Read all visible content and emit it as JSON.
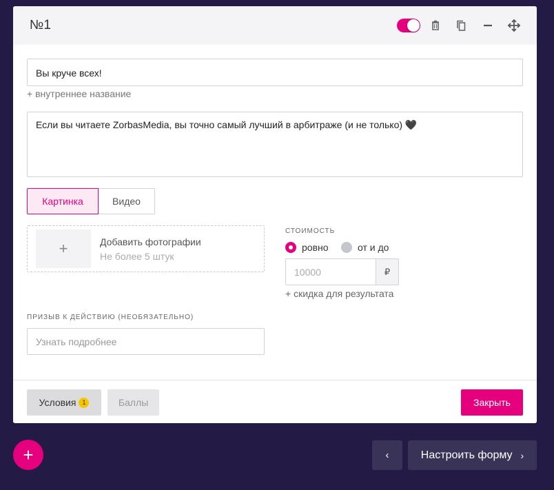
{
  "card": {
    "title": "№1",
    "name_value": "Вы круче всех!",
    "internal_name_link": "+ внутреннее название",
    "description_value": "Если вы читаете ZorbasMedia, вы точно самый лучший в арбитраже (и не только) 🖤",
    "media_tabs": [
      {
        "label": "Картинка",
        "active": true
      },
      {
        "label": "Видео",
        "active": false
      }
    ],
    "upload": {
      "plus": "+",
      "title": "Добавить фотографии",
      "hint": "Не более 5 штук"
    },
    "price": {
      "label": "СТОИМОСТЬ",
      "radio_exact": "ровно",
      "radio_range": "от и до",
      "selected": "ровно",
      "placeholder": "10000",
      "currency": "₽",
      "discount_link": "+ скидка для результата"
    },
    "cta": {
      "label": "ПРИЗЫВ К ДЕЙСТВИЮ (НЕОБЯЗАТЕЛЬНО)",
      "placeholder": "Узнать подробнее"
    },
    "footer": {
      "conditions_label": "Условия",
      "conditions_count": "1",
      "points_label": "Баллы",
      "close_label": "Закрыть"
    }
  },
  "bottom_bar": {
    "add": "+",
    "back": "‹",
    "configure_form": "Настроить форму",
    "forward": "›"
  },
  "colors": {
    "accent": "#e6007e",
    "background": "#231b45",
    "badge": "#f7c500"
  },
  "icons": [
    "toggle",
    "trash-icon",
    "copy-icon",
    "minus-icon",
    "move-icon",
    "plus-icon",
    "chevron-left-icon",
    "chevron-right-icon"
  ]
}
